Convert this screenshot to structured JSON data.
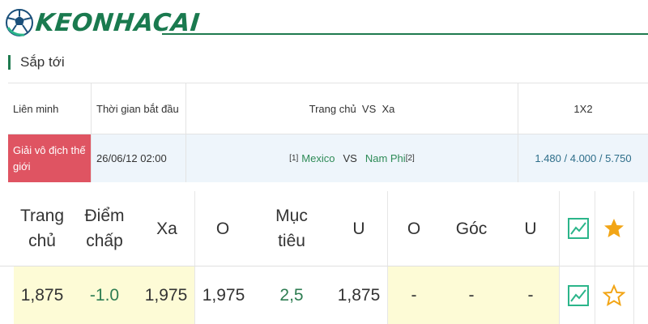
{
  "logo": {
    "text": "KEONHACAI"
  },
  "section": {
    "title": "Sắp tới"
  },
  "upcoming": {
    "headers": {
      "league": "Liên minh",
      "time": "Thời gian bắt đầu",
      "teams": "Trang chủ  VS  Xa",
      "odds": "1X2"
    },
    "match": {
      "league": "Giải vô địch thế giới",
      "time": "26/06/12 02:00",
      "home_rank": "[1]",
      "home": "Mexico",
      "vs": "VS",
      "away": "Nam Phi",
      "away_rank": "[2]",
      "odds": "1.480 / 4.000 / 5.750"
    }
  },
  "odds_table": {
    "headers": {
      "home": "Trang chủ",
      "handicap": "Điểm chấp",
      "away": "Xa",
      "over": "O",
      "goal": "Mục tiêu",
      "under": "U",
      "corner_over": "O",
      "corner": "Góc",
      "corner_under": "U"
    },
    "row": {
      "home": "1,875",
      "handicap": "-1.0",
      "away": "1,975",
      "over": "1,975",
      "goal": "2,5",
      "under": "1,875",
      "corner_over": "-",
      "corner": "-",
      "corner_under": "-"
    },
    "colors": {
      "accent": "#1f7a4f",
      "chart_icon": "#2bb58a",
      "star": "#f2a516"
    },
    "icons": {
      "chart": "line-chart-icon",
      "star_filled": "star-filled-icon",
      "star_outline": "star-outline-icon"
    }
  }
}
